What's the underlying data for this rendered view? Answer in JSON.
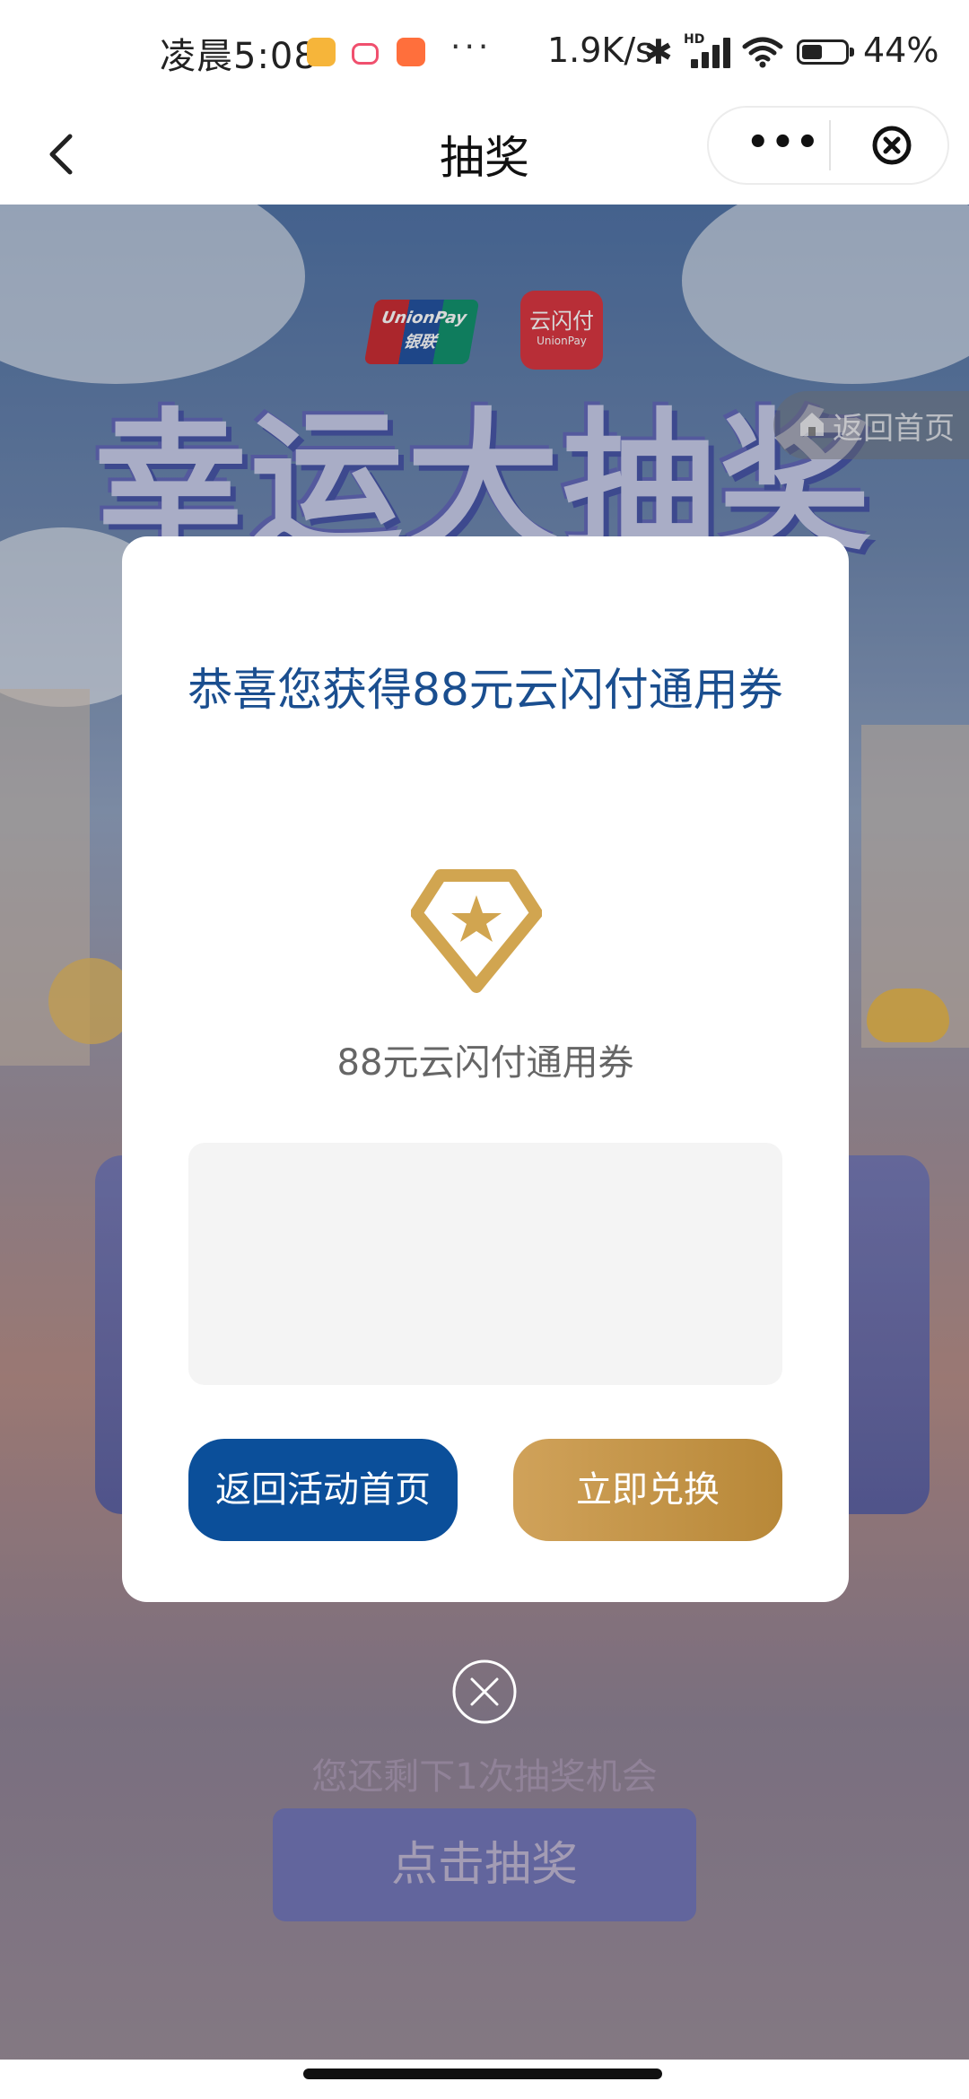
{
  "status_bar": {
    "time": "凌晨5:08",
    "dots": "···",
    "network_speed": "1.9K/s",
    "network_type": "HD",
    "battery": "44%"
  },
  "nav": {
    "title": "抽奖",
    "more": "•••"
  },
  "background": {
    "unionpay_en": "UnionPay",
    "unionpay_cn": "银联",
    "cloudpay_cn": "云闪付",
    "cloudpay_en": "UnionPay",
    "banner_title": "幸运大抽奖",
    "home_link": "返回首页",
    "remaining_text": "您还剩下1次抽奖机会",
    "draw_button": "点击抽奖"
  },
  "modal": {
    "title": "恭喜您获得88元云闪付通用券",
    "prize_icon": "diamond-star-icon",
    "prize_name": "88元云闪付通用券",
    "back_button": "返回活动首页",
    "redeem_button": "立即兑换"
  },
  "colors": {
    "primary_blue": "#0b4f9a",
    "gold": "#c7974a",
    "title_blue": "#1a4e8f"
  }
}
